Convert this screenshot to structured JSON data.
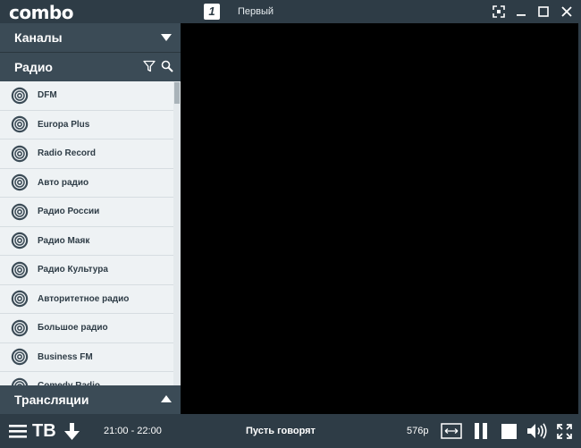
{
  "app": {
    "logo": "combo"
  },
  "titlebar": {
    "channel_logo_glyph": "1",
    "channel_name": "Первый"
  },
  "sidebar": {
    "channels_label": "Каналы",
    "radio_label": "Радио",
    "broadcasts_label": "Трансляции",
    "radio_items": [
      {
        "label": "DFM"
      },
      {
        "label": "Europa Plus"
      },
      {
        "label": "Radio Record"
      },
      {
        "label": "Авто радио"
      },
      {
        "label": "Радио России"
      },
      {
        "label": "Радио Маяк"
      },
      {
        "label": "Радио Культура"
      },
      {
        "label": "Авторитетное радио"
      },
      {
        "label": "Большое радио"
      },
      {
        "label": "Business FM"
      },
      {
        "label": "Comedy Radio"
      }
    ]
  },
  "player": {
    "tv_label": "ТВ",
    "time_range": "21:00 - 22:00",
    "program_title": "Пусть говорят",
    "quality": "576p"
  },
  "colors": {
    "bar": "#2e3c46",
    "header": "#3b4b56",
    "list_bg": "#eef2f4",
    "text_dark": "#2e3c46",
    "video_bg": "#000000"
  }
}
